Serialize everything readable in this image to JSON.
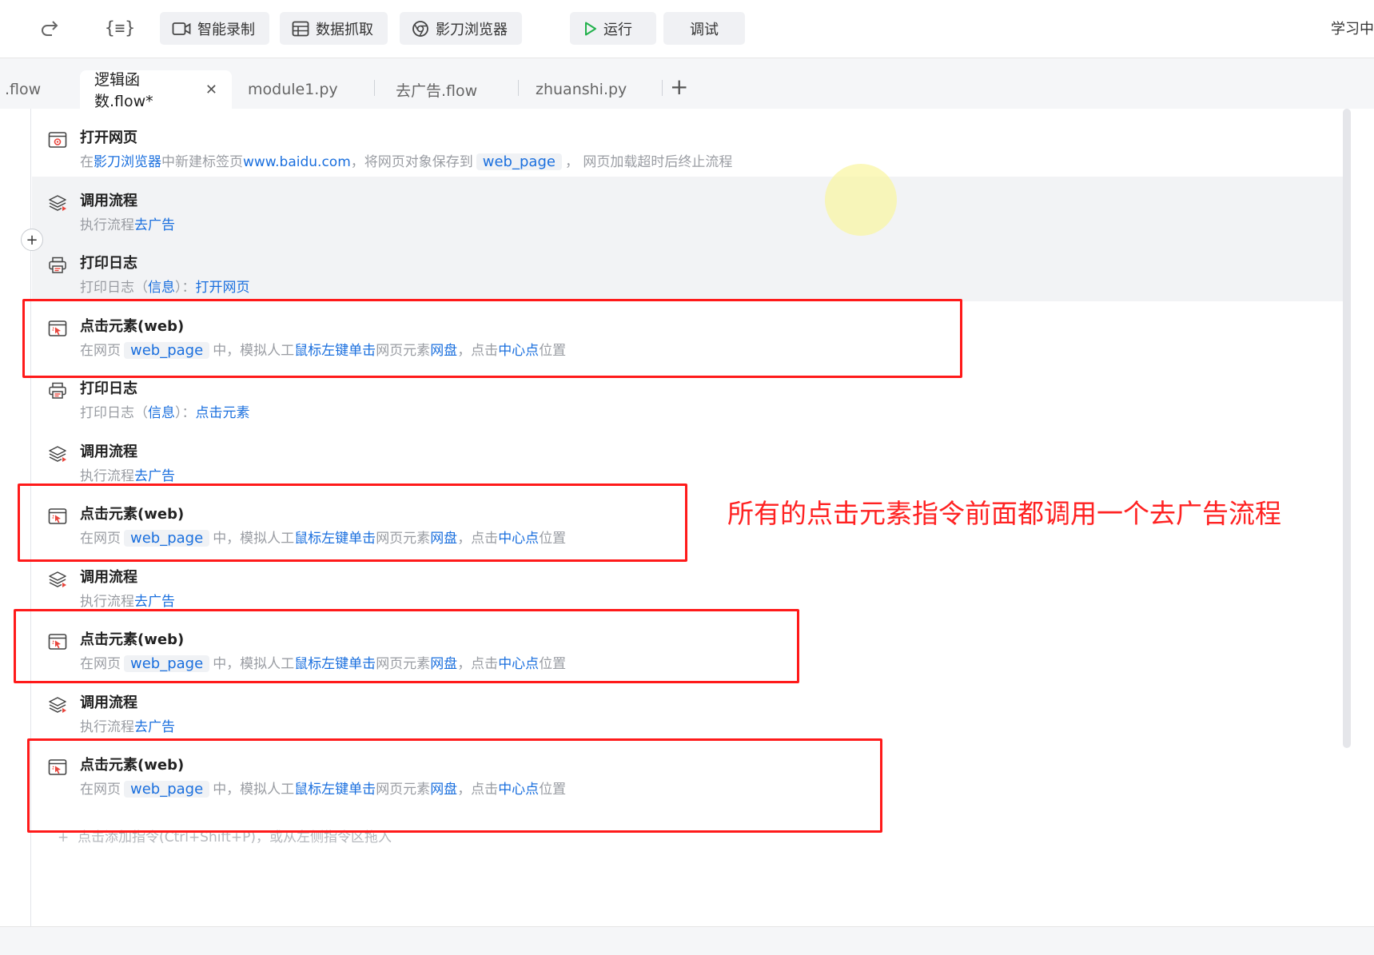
{
  "toolbar": {
    "buttons": [
      {
        "label": "智能录制",
        "icon": "video-icon"
      },
      {
        "label": "数据抓取",
        "icon": "table-icon"
      },
      {
        "label": "影刀浏览器",
        "icon": "browser-icon"
      },
      {
        "label": "运行",
        "icon": "play-icon"
      },
      {
        "label": "调试",
        "icon": ""
      }
    ],
    "right_label": "学习中"
  },
  "tabs": [
    {
      "label": ".flow"
    },
    {
      "label": "逻辑函数.flow*"
    },
    {
      "label": "module1.py"
    },
    {
      "label": "去广告.flow"
    },
    {
      "label": "zhuanshi.py"
    }
  ],
  "steps": [
    {
      "title": "打开网页",
      "icon": "open-web-icon",
      "desc": [
        {
          "t": "在",
          "k": false
        },
        {
          "t": "影刀浏览器",
          "k": true
        },
        {
          "t": "中新建标签页",
          "k": false
        },
        {
          "t": "www.baidu.com",
          "k": true
        },
        {
          "t": "，将网页对象保存到",
          "k": false
        },
        {
          "t": "web_page",
          "chip": true
        },
        {
          "t": "， 网页加载超时后终止流程",
          "k": false
        }
      ]
    },
    {
      "title": "调用流程",
      "icon": "layers-icon",
      "desc": [
        {
          "t": "执行流程",
          "k": false
        },
        {
          "t": "去广告",
          "k": true
        }
      ]
    },
    {
      "title": "打印日志",
      "icon": "printer-icon",
      "desc": [
        {
          "t": "打印日志（",
          "k": false
        },
        {
          "t": "信息",
          "k": true
        },
        {
          "t": "）：",
          "k": false
        },
        {
          "t": "打开网页",
          "k": true
        }
      ]
    },
    {
      "title": "点击元素(web)",
      "icon": "click-element-icon",
      "desc": [
        {
          "t": "在网页",
          "k": false
        },
        {
          "t": "web_page",
          "chip": true
        },
        {
          "t": "中，模拟人工",
          "k": false
        },
        {
          "t": "鼠标左键单击",
          "k": true
        },
        {
          "t": "网页元素",
          "k": false
        },
        {
          "t": "网盘",
          "k": true
        },
        {
          "t": "，点击",
          "k": false
        },
        {
          "t": "中心点",
          "k": true
        },
        {
          "t": "位置",
          "k": false
        }
      ]
    },
    {
      "title": "打印日志",
      "icon": "printer-icon",
      "desc": [
        {
          "t": "打印日志（",
          "k": false
        },
        {
          "t": "信息",
          "k": true
        },
        {
          "t": "）：",
          "k": false
        },
        {
          "t": "点击元素",
          "k": true
        }
      ]
    },
    {
      "title": "调用流程",
      "icon": "layers-icon",
      "desc": [
        {
          "t": "执行流程",
          "k": false
        },
        {
          "t": "去广告",
          "k": true
        }
      ]
    },
    {
      "title": "点击元素(web)",
      "icon": "click-element-icon",
      "desc": [
        {
          "t": "在网页",
          "k": false
        },
        {
          "t": "web_page",
          "chip": true
        },
        {
          "t": "中，模拟人工",
          "k": false
        },
        {
          "t": "鼠标左键单击",
          "k": true
        },
        {
          "t": "网页元素",
          "k": false
        },
        {
          "t": "网盘",
          "k": true
        },
        {
          "t": "，点击",
          "k": false
        },
        {
          "t": "中心点",
          "k": true
        },
        {
          "t": "位置",
          "k": false
        }
      ]
    },
    {
      "title": "调用流程",
      "icon": "layers-icon",
      "desc": [
        {
          "t": "执行流程",
          "k": false
        },
        {
          "t": "去广告",
          "k": true
        }
      ]
    },
    {
      "title": "点击元素(web)",
      "icon": "click-element-icon",
      "desc": [
        {
          "t": "在网页",
          "k": false
        },
        {
          "t": "web_page",
          "chip": true
        },
        {
          "t": "中，模拟人工",
          "k": false
        },
        {
          "t": "鼠标左键单击",
          "k": true
        },
        {
          "t": "网页元素",
          "k": false
        },
        {
          "t": "网盘",
          "k": true
        },
        {
          "t": "，点击",
          "k": false
        },
        {
          "t": "中心点",
          "k": true
        },
        {
          "t": "位置",
          "k": false
        }
      ]
    },
    {
      "title": "调用流程",
      "icon": "layers-icon",
      "desc": [
        {
          "t": "执行流程",
          "k": false
        },
        {
          "t": "去广告",
          "k": true
        }
      ]
    },
    {
      "title": "点击元素(web)",
      "icon": "click-element-icon",
      "desc": [
        {
          "t": "在网页",
          "k": false
        },
        {
          "t": "web_page",
          "chip": true
        },
        {
          "t": "中，模拟人工",
          "k": false
        },
        {
          "t": "鼠标左键单击",
          "k": true
        },
        {
          "t": "网页元素",
          "k": false
        },
        {
          "t": "网盘",
          "k": true
        },
        {
          "t": "，点击",
          "k": false
        },
        {
          "t": "中心点",
          "k": true
        },
        {
          "t": "位置",
          "k": false
        }
      ]
    }
  ],
  "add_hint": "点击添加指令(Ctrl+Shift+P)，或从左侧指令区拖入",
  "annotation": "所有的点击元素指令前面都调用一个去广告流程",
  "colors": {
    "keyword": "#1a6fde",
    "annotation": "#ff1a1a",
    "run_green": "#22b14c"
  }
}
